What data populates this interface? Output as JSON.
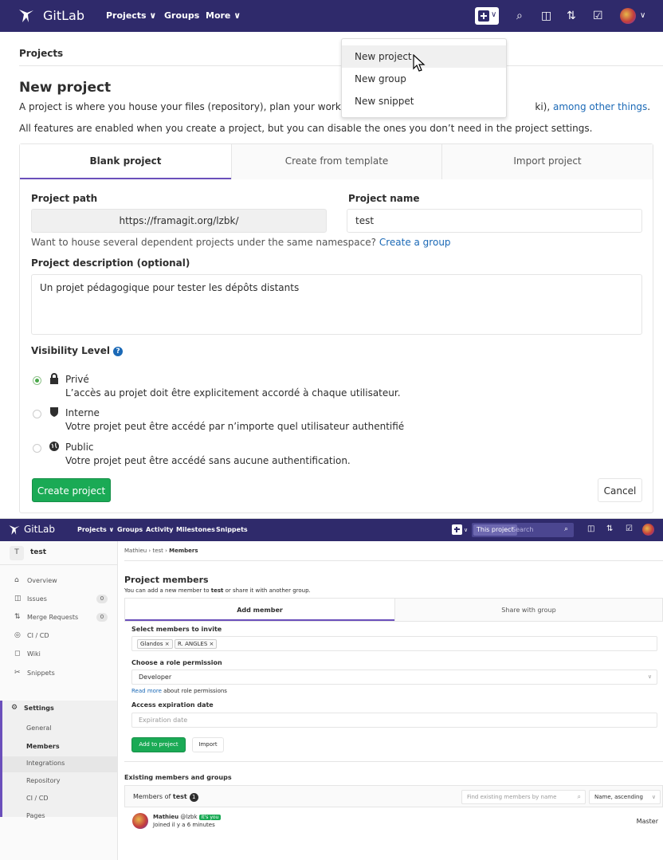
{
  "shot1": {
    "nav": {
      "brand": "GitLab",
      "projects": "Projects ∨",
      "groups": "Groups",
      "more": "More ∨",
      "plus_chevron": "∨",
      "avatar_chevron": "∨"
    },
    "dropdown": {
      "items": [
        {
          "label": "New project"
        },
        {
          "label": "New group"
        },
        {
          "label": "New snippet"
        }
      ]
    },
    "breadcrumb": "Projects",
    "title": "New project",
    "intro_line1_a": "A project is where you house your files (repository), plan your work (issues",
    "intro_line1_b": "ki), ",
    "intro_line1_link": "among other things",
    "intro_line1_end": ".",
    "intro_line2": "All features are enabled when you create a project, but you can disable the ones you don’t need in the project settings.",
    "tabs": [
      "Blank project",
      "Create from template",
      "Import project"
    ],
    "form": {
      "path_label": "Project path",
      "path_value": "https://framagit.org/lzbk/",
      "name_label": "Project name",
      "name_value": "test",
      "help_text": "Want to house several dependent projects under the same namespace? ",
      "help_link": "Create a group",
      "desc_label": "Project description (optional)",
      "desc_value": "Un projet pédagogique pour tester les dépôts distants",
      "visibility_label": "Visibility Level",
      "visibility": [
        {
          "label": "Privé",
          "help": "L’accès au projet doit être explicitement accordé à chaque utilisateur.",
          "selected": true
        },
        {
          "label": "Interne",
          "help": "Votre projet peut être accédé par n’importe quel utilisateur authentifié",
          "selected": false
        },
        {
          "label": "Public",
          "help": "Votre projet peut être accédé sans aucune authentification.",
          "selected": false
        }
      ],
      "create_button": "Create project",
      "cancel_button": "Cancel"
    }
  },
  "shot2": {
    "nav": {
      "brand": "GitLab",
      "projects": "Projects ∨",
      "groups": "Groups",
      "activity": "Activity",
      "milestones": "Milestones",
      "snippets": "Snippets",
      "search_scope": "This project",
      "search_placeholder": "Search"
    },
    "sidebar": {
      "avatar_letter": "T",
      "project": "test",
      "items": [
        {
          "icon": "⌂",
          "label": "Overview"
        },
        {
          "icon": "◫",
          "label": "Issues",
          "badge": "0"
        },
        {
          "icon": "⇅",
          "label": "Merge Requests",
          "badge": "0"
        },
        {
          "icon": "◎",
          "label": "CI / CD"
        },
        {
          "icon": "◻",
          "label": "Wiki"
        },
        {
          "icon": "✂",
          "label": "Snippets"
        },
        {
          "icon": "⚙",
          "label": "Settings"
        }
      ],
      "settings_sub": [
        "General",
        "Members",
        "Integrations",
        "Repository",
        "CI / CD",
        "Pages"
      ]
    },
    "breadcrumb": {
      "owner": "Mathieu",
      "project": "test",
      "page": "Members"
    },
    "title": "Project members",
    "subtitle_a": "You can add a new member to ",
    "subtitle_b": "test",
    "subtitle_c": " or share it with another group.",
    "tabs": [
      "Add member",
      "Share with group"
    ],
    "select_label": "Select members to invite",
    "tokens": [
      "Glandos ×",
      "R. ANGLES ×"
    ],
    "role_label": "Choose a role permission",
    "role_value": "Developer",
    "read_more": "Read more",
    "read_more_rest": " about role permissions",
    "expiry_label": "Access expiration date",
    "expiry_placeholder": "Expiration date",
    "add_button": "Add to project",
    "import_button": "Import",
    "existing_title": "Existing members and groups",
    "members_of": "Members of ",
    "members_of_project": "test",
    "member_count": "1",
    "find_placeholder": "Find existing members by name",
    "sort_value": "Name, ascending",
    "member": {
      "name": "Mathieu",
      "handle": "@lzbk",
      "badge": "It's you",
      "joined": "Joined il y a 6 minutes",
      "role": "Master"
    }
  }
}
